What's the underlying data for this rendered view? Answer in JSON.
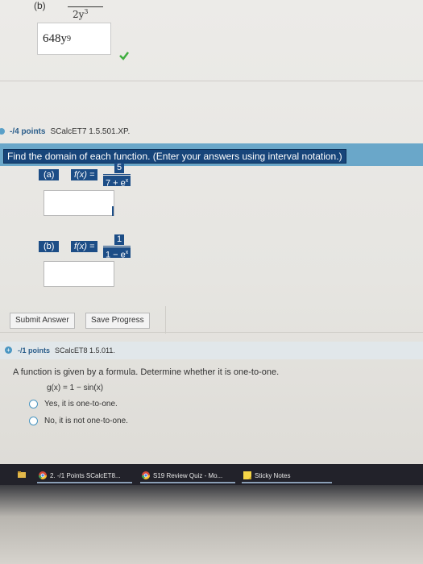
{
  "previous": {
    "part_label": "(b)",
    "fraction_denominator": "2y",
    "fraction_denominator_exp": "3",
    "answer_base": "648y",
    "answer_exp": "9"
  },
  "question2": {
    "points": "-/4 points",
    "code": "SCalcET7 1.5.501.XP.",
    "instruction": "Find the domain of each function. (Enter your answers using interval notation.)",
    "part_a": {
      "label": "(a)",
      "func": "f(x) =",
      "numerator": "5",
      "denominator": "7 + e",
      "denominator_exp": "x"
    },
    "part_b": {
      "label": "(b)",
      "func": "f(x) =",
      "numerator": "1",
      "denominator": "1 − e",
      "denominator_exp": "x"
    },
    "submit_label": "Submit Answer",
    "save_label": "Save Progress"
  },
  "question3": {
    "points": "-/1 points",
    "code": "SCalcET8 1.5.011.",
    "text": "A function is given by a formula. Determine whether it is one-to-one.",
    "formula": "g(x) = 1 − sin(x)",
    "options": [
      "Yes, it is one-to-one.",
      "No, it is not one-to-one."
    ]
  },
  "taskbar": {
    "items": [
      "2. -/1 Points SCalcET8...",
      "S19 Review Quiz - Mo...",
      "Sticky Notes"
    ]
  },
  "colors": {
    "highlight": "#17457a",
    "header_bar": "#6aa7c9",
    "check": "#3fae3f"
  }
}
